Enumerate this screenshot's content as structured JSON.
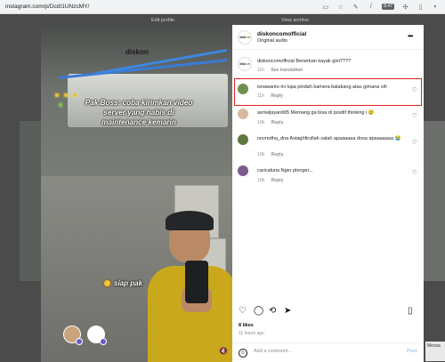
{
  "browser": {
    "url": "instagram.com/p/DcdI1UNzcMY/",
    "ext_badge": "8.47"
  },
  "background": {
    "edit_profile": "Edit profile",
    "view_archive": "View archive",
    "side_label": "Messa"
  },
  "video": {
    "logo_text": "diskon",
    "caption_line1": "Pak Boss: coba kirimkan video",
    "caption_line2": "server yang habis di",
    "caption_line3": "maintenance kemarin",
    "caption_bottom": "siap pak"
  },
  "post": {
    "username": "diskoncomofficial",
    "audio": "Original audio",
    "likes": "8 likes",
    "time_ago": "11 hours ago",
    "comment_placeholder": "Add a comment...",
    "post_label": "Post"
  },
  "comments": [
    {
      "user": "diskoncomofficial",
      "text": "Benerkan kayak gini????",
      "time": "11h",
      "action": "See translation"
    },
    {
      "user": "isnawanto",
      "text": "ini lupa pindah kamera balakang atau gimana sih",
      "time": "11h",
      "action": "Reply"
    },
    {
      "user": "asriwijayanti95",
      "text": "Memang ga bisa di positif thinking i 😢",
      "time": "10h",
      "action": "Reply"
    },
    {
      "user": "novredha_dna",
      "text": "Astaghfirullah salah apaaaaaa dosa apaaaaaaa 😭",
      "time": "10h",
      "action": "Reply"
    },
    {
      "user": "caricaluna",
      "text": "Nger plenger...",
      "time": "10h",
      "action": "Reply"
    }
  ],
  "icons": {
    "more": "more-options-icon",
    "heart": "heart-icon",
    "comment": "comment-icon",
    "share": "share-icon",
    "save": "bookmark-icon",
    "emoji": "emoji-icon",
    "mute": "mute-icon"
  },
  "colors": {
    "highlight": "#e02424",
    "post_link": "#a7c7f2"
  }
}
